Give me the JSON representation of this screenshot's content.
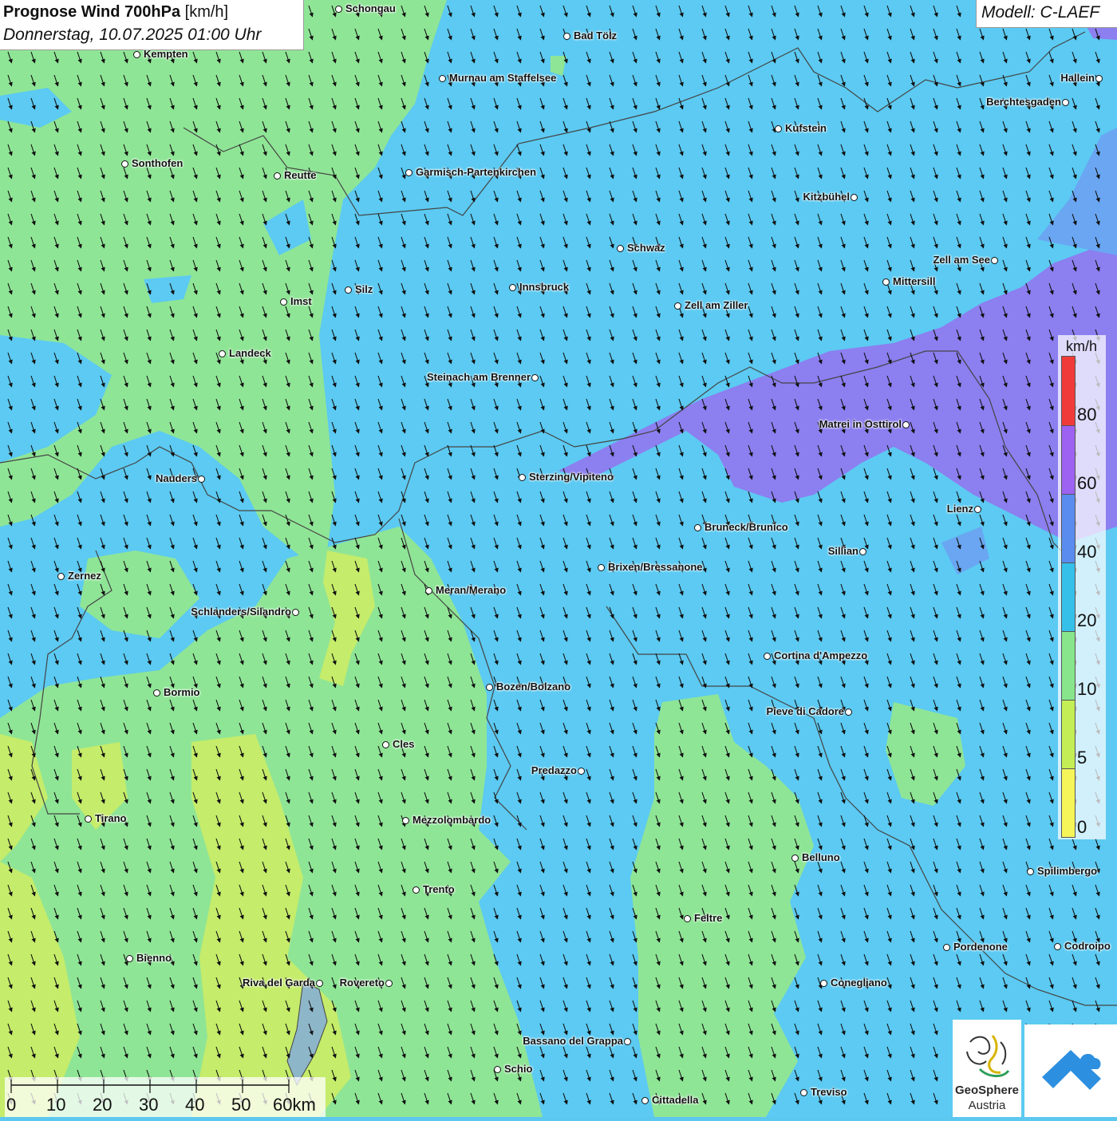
{
  "header": {
    "title_bold": "Prognose Wind 700hPa",
    "title_unit": "[km/h]",
    "datetime": "Donnerstag, 10.07.2025 01:00 Uhr"
  },
  "model": {
    "label": "Modell: C-LAEF"
  },
  "legend": {
    "unit": "km/h",
    "ticks": [
      "0",
      "5",
      "10",
      "20",
      "40",
      "60",
      "80"
    ],
    "bands": [
      {
        "from": 0,
        "to": 5,
        "color": "#f5f55a"
      },
      {
        "from": 5,
        "to": 10,
        "color": "#c3ee55"
      },
      {
        "from": 10,
        "to": 20,
        "color": "#88e58c"
      },
      {
        "from": 20,
        "to": 40,
        "color": "#35c0ea"
      },
      {
        "from": 40,
        "to": 60,
        "color": "#5a8cf0"
      },
      {
        "from": 60,
        "to": 80,
        "color": "#9e62f2"
      },
      {
        "from": 80,
        "to": 100,
        "color": "#f03a3a"
      }
    ]
  },
  "scale_bar": {
    "labels": [
      "0",
      "10",
      "20",
      "30",
      "40",
      "50",
      "60km"
    ]
  },
  "logos": {
    "geosphere_name": "GeoSphere",
    "geosphere_sub": "Austria"
  },
  "wind_arrows": {
    "direction": "north-west wind, arrows pointing south-south-east"
  },
  "cities": [
    {
      "name": "Schongau"
    },
    {
      "name": "Bad Tölz"
    },
    {
      "name": "Kempten"
    },
    {
      "name": "Murnau am Staffelsee"
    },
    {
      "name": "Hallein"
    },
    {
      "name": "Berchtesgaden"
    },
    {
      "name": "Kufstein"
    },
    {
      "name": "Sonthofen"
    },
    {
      "name": "Reutte"
    },
    {
      "name": "Garmisch-Partenkirchen"
    },
    {
      "name": "Kitzbühel"
    },
    {
      "name": "Schwaz"
    },
    {
      "name": "Zell am See"
    },
    {
      "name": "Mittersill"
    },
    {
      "name": "Innsbruck"
    },
    {
      "name": "Silz"
    },
    {
      "name": "Imst"
    },
    {
      "name": "Zell am Ziller"
    },
    {
      "name": "Landeck"
    },
    {
      "name": "Steinach am Brenner"
    },
    {
      "name": "Matrei in Osttirol"
    },
    {
      "name": "Nauders"
    },
    {
      "name": "Sterzing/Vipiteno"
    },
    {
      "name": "Lienz"
    },
    {
      "name": "Bruneck/Brunico"
    },
    {
      "name": "Sillian"
    },
    {
      "name": "Brixen/Bressanone"
    },
    {
      "name": "Zernez"
    },
    {
      "name": "Meran/Merano"
    },
    {
      "name": "Schlanders/Silandro"
    },
    {
      "name": "Cortina d'Ampezzo"
    },
    {
      "name": "Bozen/Bolzano"
    },
    {
      "name": "Bormio"
    },
    {
      "name": "Pieve di Cadore"
    },
    {
      "name": "Cles"
    },
    {
      "name": "Predazzo"
    },
    {
      "name": "Tirano"
    },
    {
      "name": "Mezzolombardo"
    },
    {
      "name": "Belluno"
    },
    {
      "name": "Spilimbergo"
    },
    {
      "name": "Trento"
    },
    {
      "name": "Feltre"
    },
    {
      "name": "Bienno"
    },
    {
      "name": "Pordenone"
    },
    {
      "name": "Codroipo"
    },
    {
      "name": "Riva del Garda"
    },
    {
      "name": "Rovereto"
    },
    {
      "name": "Conegliano"
    },
    {
      "name": "Bassano del Grappa"
    },
    {
      "name": "Schio"
    },
    {
      "name": "Treviso"
    },
    {
      "name": "Cittadella"
    }
  ]
}
